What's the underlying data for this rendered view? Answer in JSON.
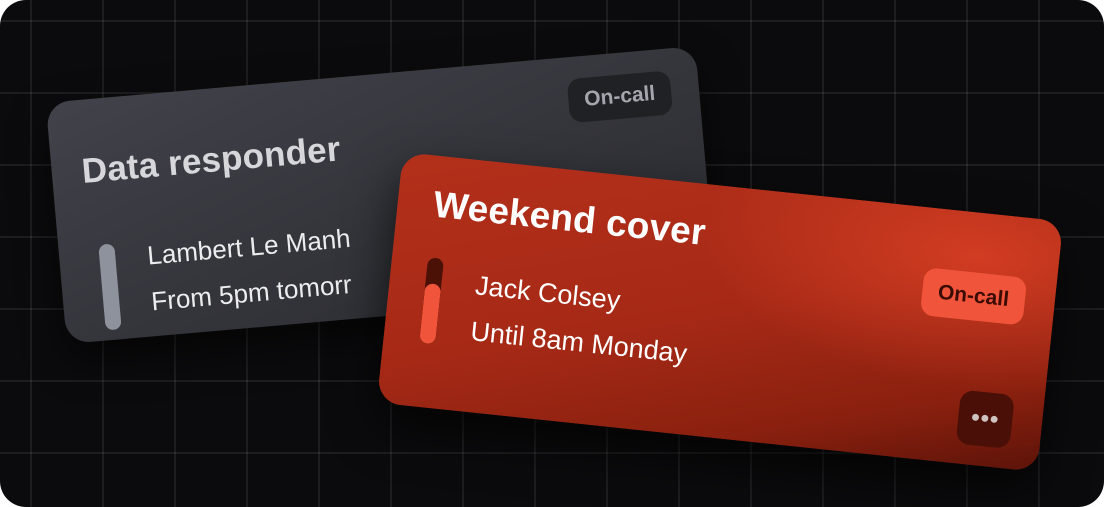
{
  "cards": [
    {
      "title": "Data responder",
      "badge": "On-call",
      "person": "Lambert Le Manh",
      "schedule": "From 5pm tomorr",
      "progress": 1.0
    },
    {
      "title": "Weekend cover",
      "badge": "On-call",
      "person": "Jack Colsey",
      "schedule": "Until 8am Monday",
      "progress": 0.7,
      "more_icon": "more-horizontal-icon",
      "more_glyph": "•••"
    }
  ],
  "colors": {
    "background": "#0b0b0d",
    "card_back": "#3a3b41",
    "card_front": "#a62916",
    "accent": "#f0543a"
  }
}
